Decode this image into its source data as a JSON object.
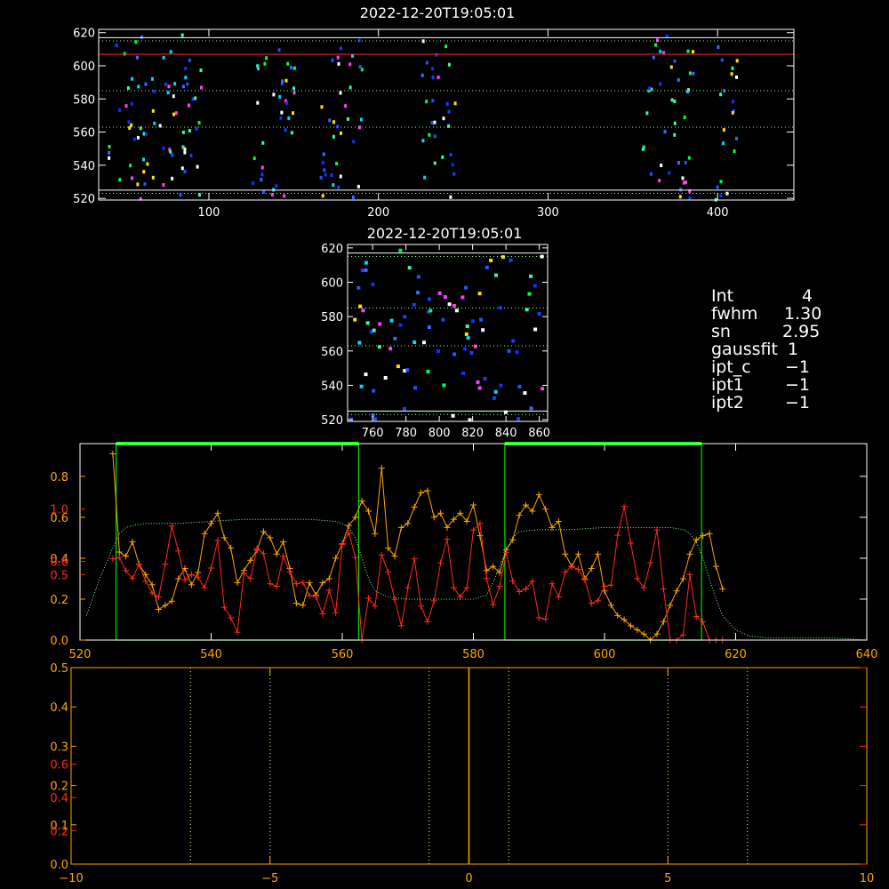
{
  "colors": {
    "background": "#000000",
    "axis": "#ffffff",
    "orange": "#ffa500",
    "red": "#ff2a1a",
    "green": "#00e000",
    "bright_green": "#00ff00",
    "dotted_green": "#90ff90",
    "white": "#ffffff"
  },
  "info": [
    {
      "key": "Int",
      "value": "4"
    },
    {
      "key": "fwhm",
      "value": "1.30"
    },
    {
      "key": "sn",
      "value": "2.95"
    },
    {
      "key": "gaussfit",
      "value": "1"
    },
    {
      "key": "ipt_c",
      "value": "−1"
    },
    {
      "key": "ipt1",
      "value": "−1"
    },
    {
      "key": "ipt2",
      "value": "−1"
    }
  ],
  "chart_data": [
    {
      "type": "heatmap",
      "title": "2022-12-20T19:05:01",
      "xlim": [
        35,
        445
      ],
      "ylim": [
        519,
        622
      ],
      "xticks": [
        "100",
        "200",
        "300",
        "400"
      ],
      "yticks": [
        "520",
        "540",
        "560",
        "580",
        "600",
        "620"
      ],
      "hlines": [
        {
          "y": 617,
          "color": "white"
        },
        {
          "y": 615,
          "color": "dotted_green"
        },
        {
          "y": 607,
          "color": "red"
        },
        {
          "y": 585,
          "color": "dotted_green"
        },
        {
          "y": 563,
          "color": "dotted_green"
        },
        {
          "y": 525,
          "color": "white"
        },
        {
          "y": 523,
          "color": "dotted_green"
        }
      ],
      "clusters": [
        [
          40,
          95
        ],
        [
          125,
          150
        ],
        [
          165,
          190
        ],
        [
          225,
          245
        ],
        [
          355,
          385
        ],
        [
          398,
          412
        ]
      ]
    },
    {
      "type": "heatmap",
      "title": "2022-12-20T19:05:01",
      "xlim": [
        745,
        865
      ],
      "ylim": [
        519,
        622
      ],
      "xticks": [
        "760",
        "780",
        "800",
        "820",
        "840",
        "860"
      ],
      "yticks": [
        "520",
        "540",
        "560",
        "580",
        "600",
        "620"
      ],
      "hlines": [
        {
          "y": 617,
          "color": "white"
        },
        {
          "y": 615,
          "color": "dotted_green"
        },
        {
          "y": 585,
          "color": "dotted_green"
        },
        {
          "y": 563,
          "color": "dotted_green"
        },
        {
          "y": 525,
          "color": "white"
        },
        {
          "y": 523,
          "color": "dotted_green"
        }
      ]
    },
    {
      "type": "line",
      "xlim": [
        520,
        640
      ],
      "ylim": [
        0,
        0.6
      ],
      "xticks": [
        "520",
        "540",
        "560",
        "580",
        "600",
        "620",
        "640"
      ],
      "left_axis_labels": [
        {
          "value": 0.0,
          "text": "0.0",
          "color": "orange"
        },
        {
          "value": 0.2,
          "text": "0.2",
          "color": "orange"
        },
        {
          "value": 0.4,
          "text": "0.4",
          "color": "orange"
        },
        {
          "value": 0.6,
          "text": "0.6",
          "color": "orange"
        },
        {
          "value": 0.8,
          "text": "0.8",
          "color": "orange"
        },
        {
          "value": 1.0,
          "text": "1.0",
          "color": "red"
        },
        {
          "value": 0.5,
          "text": "0.5",
          "color": "red"
        },
        {
          "value": 0.6,
          "text": "0.6",
          "color": "red"
        }
      ],
      "green_boxes": [
        [
          525.5,
          562.5
        ],
        [
          584.8,
          614.8
        ]
      ],
      "series": [
        {
          "color": "orange",
          "x": [
            525,
            526,
            527,
            528,
            529,
            530,
            531,
            532,
            533,
            534,
            535,
            536,
            537,
            538,
            539,
            540,
            541,
            542,
            543,
            544,
            545,
            546,
            547,
            548,
            549,
            550,
            551,
            552,
            553,
            554,
            555,
            556,
            557,
            558,
            559,
            560,
            561,
            562,
            563,
            564,
            565,
            566,
            567,
            568,
            569,
            570,
            571,
            572,
            573,
            574,
            575,
            576,
            577,
            578,
            579,
            580,
            581,
            582,
            583,
            584,
            585,
            586,
            587,
            588,
            589,
            590,
            591,
            592,
            593,
            594,
            595,
            596,
            597,
            598,
            599,
            600,
            601,
            602,
            603,
            604,
            605,
            606,
            607,
            608,
            609,
            610,
            611,
            612,
            613,
            614,
            615,
            616,
            617,
            618
          ],
          "y": [
            0.91,
            0.43,
            0.41,
            0.48,
            0.37,
            0.32,
            0.27,
            0.15,
            0.17,
            0.19,
            0.3,
            0.35,
            0.27,
            0.33,
            0.52,
            0.57,
            0.62,
            0.5,
            0.45,
            0.28,
            0.34,
            0.39,
            0.44,
            0.53,
            0.5,
            0.42,
            0.48,
            0.35,
            0.18,
            0.17,
            0.28,
            0.22,
            0.28,
            0.3,
            0.4,
            0.47,
            0.56,
            0.6,
            0.68,
            0.63,
            0.52,
            0.84,
            0.45,
            0.41,
            0.55,
            0.57,
            0.65,
            0.72,
            0.73,
            0.6,
            0.62,
            0.55,
            0.59,
            0.62,
            0.58,
            0.66,
            0.51,
            0.34,
            0.36,
            0.33,
            0.44,
            0.49,
            0.61,
            0.66,
            0.63,
            0.71,
            0.64,
            0.55,
            0.58,
            0.42,
            0.36,
            0.42,
            0.3,
            0.35,
            0.42,
            0.24,
            0.17,
            0.12,
            0.1,
            0.07,
            0.05,
            0.03,
            0.0,
            0.03,
            0.09,
            0.17,
            0.24,
            0.3,
            0.42,
            0.49,
            0.51,
            0.52,
            0.36,
            0.25
          ]
        },
        {
          "color": "red",
          "x": [
            525,
            526,
            527,
            528,
            529,
            530,
            531,
            532,
            533,
            534,
            535,
            536,
            537,
            538,
            539,
            540,
            541,
            542,
            543,
            544,
            545,
            546,
            547,
            548,
            549,
            550,
            551,
            552,
            553,
            554,
            555,
            556,
            557,
            558,
            559,
            560,
            561,
            562,
            563,
            564,
            565,
            566,
            567,
            568,
            569,
            570,
            571,
            572,
            573,
            574,
            575,
            576,
            577,
            578,
            579,
            580,
            581,
            582,
            583,
            584,
            585,
            586,
            587,
            588,
            589,
            590,
            591,
            592,
            593,
            594,
            595,
            596,
            597,
            598,
            599,
            600,
            601,
            602,
            603,
            604,
            605,
            606,
            607,
            608,
            609,
            610,
            611,
            612,
            613,
            614,
            615,
            616,
            617,
            618
          ],
          "y": [
            0.62,
            0.63,
            0.53,
            0.47,
            0.58,
            0.45,
            0.36,
            0.33,
            0.58,
            0.87,
            0.68,
            0.46,
            0.5,
            0.48,
            0.4,
            0.55,
            0.76,
            0.25,
            0.17,
            0.06,
            0.51,
            0.47,
            0.7,
            0.66,
            0.43,
            0.41,
            0.64,
            0.52,
            0.43,
            0.44,
            0.34,
            0.33,
            0.2,
            0.38,
            0.21,
            0.73,
            0.82,
            0.63,
            0.0,
            0.32,
            0.26,
            0.65,
            0.52,
            0.31,
            0.11,
            0.4,
            0.62,
            0.26,
            0.14,
            0.3,
            0.59,
            0.77,
            0.4,
            0.33,
            0.4,
            0.84,
            0.89,
            0.47,
            0.27,
            0.41,
            0.67,
            0.45,
            0.37,
            0.39,
            0.45,
            0.17,
            0.16,
            0.43,
            0.33,
            0.52,
            0.56,
            0.54,
            0.46,
            0.28,
            0.3,
            0.41,
            0.42,
            0.8,
            1.02,
            0.74,
            0.47,
            0.4,
            0.59,
            0.84,
            0.39,
            0.0,
            0.0,
            0.04,
            0.5,
            0.18,
            0.14,
            0.0,
            0.0,
            0.0
          ]
        },
        {
          "color": "dotted_green",
          "style": "dotted",
          "x": [
            521,
            523,
            525,
            526,
            527,
            528,
            530,
            535,
            540,
            545,
            550,
            555,
            559,
            560,
            561,
            562,
            563,
            564,
            565,
            567,
            570,
            575,
            580,
            582,
            583,
            584,
            585,
            586,
            587,
            590,
            595,
            600,
            605,
            610,
            612,
            613,
            614,
            615,
            616,
            617,
            618,
            620,
            622,
            625,
            630,
            635,
            640
          ],
          "y": [
            0.12,
            0.3,
            0.45,
            0.52,
            0.55,
            0.56,
            0.57,
            0.57,
            0.58,
            0.59,
            0.59,
            0.59,
            0.58,
            0.57,
            0.55,
            0.5,
            0.4,
            0.3,
            0.24,
            0.21,
            0.2,
            0.2,
            0.2,
            0.22,
            0.28,
            0.36,
            0.44,
            0.5,
            0.53,
            0.54,
            0.54,
            0.55,
            0.55,
            0.55,
            0.54,
            0.52,
            0.48,
            0.4,
            0.3,
            0.2,
            0.12,
            0.05,
            0.02,
            0.01,
            0.01,
            0.01,
            0.0
          ]
        }
      ]
    },
    {
      "type": "line",
      "xlim": [
        -10,
        10
      ],
      "ylim": [
        0,
        0.5
      ],
      "xticks": [
        "−10",
        "−5",
        "0",
        "5",
        "10"
      ],
      "left_axis_labels": [
        {
          "value": 0.0,
          "text": "0.0",
          "color": "orange"
        },
        {
          "value": 0.1,
          "text": "0.1",
          "color": "orange"
        },
        {
          "value": 0.2,
          "text": "0.2",
          "color": "orange"
        },
        {
          "value": 0.3,
          "text": "0.3",
          "color": "orange"
        },
        {
          "value": 0.4,
          "text": "0.4",
          "color": "orange"
        },
        {
          "value": 0.5,
          "text": "0.5",
          "color": "orange"
        },
        {
          "value": 0.6,
          "text": "0.6",
          "color": "red"
        },
        {
          "value": 0.4,
          "text": "0.4",
          "color": "red"
        },
        {
          "value": 0.2,
          "text": "0.2",
          "color": "red"
        }
      ],
      "vlines_dotted": [
        -7,
        -5,
        -1,
        1,
        5,
        7
      ],
      "vline_solid": 0
    }
  ]
}
